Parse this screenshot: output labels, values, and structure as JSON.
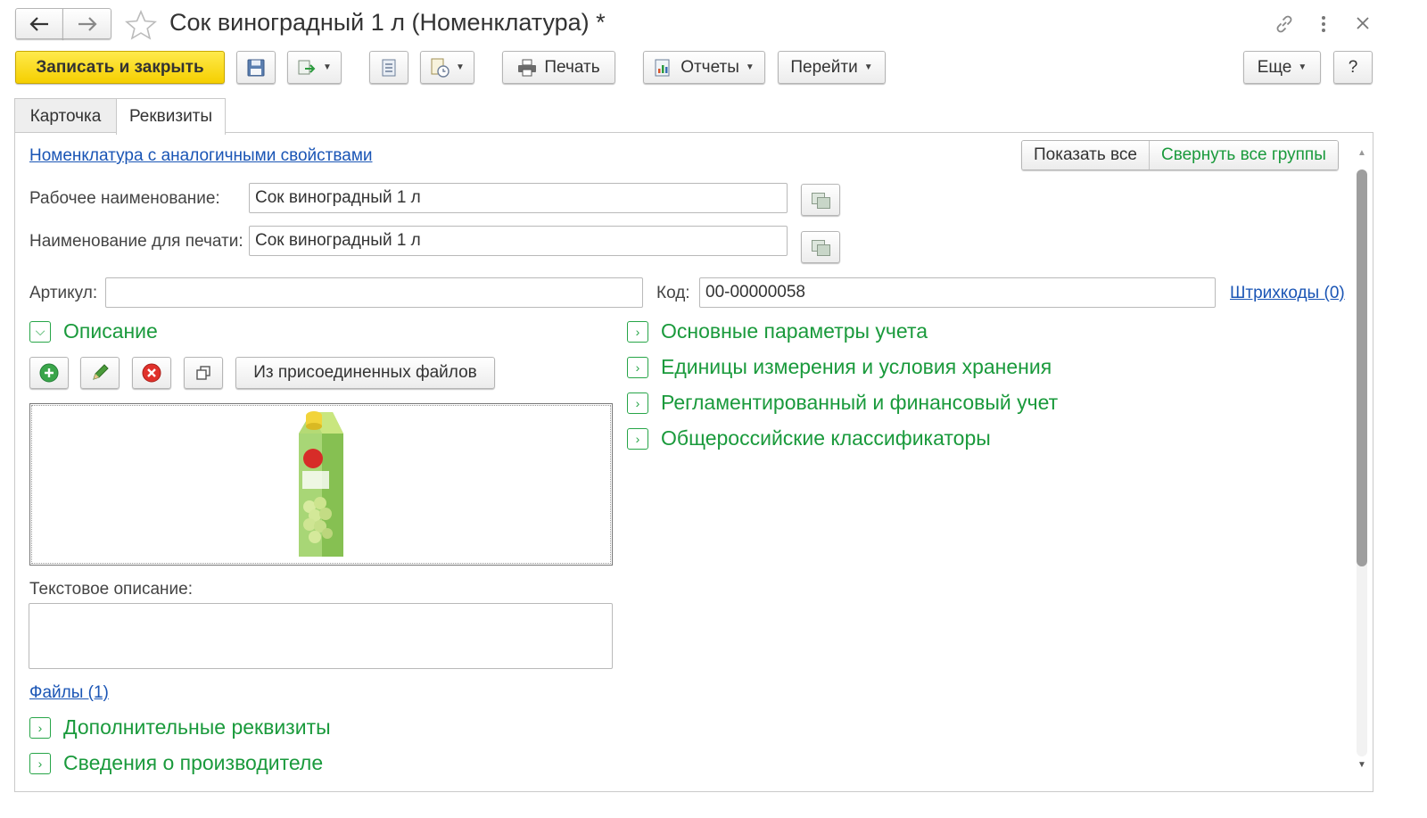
{
  "window": {
    "title": "Сок виноградный 1 л (Номенклатура) *"
  },
  "toolbar": {
    "save_close_label": "Записать и закрыть",
    "print_label": "Печать",
    "reports_label": "Отчеты",
    "goto_label": "Перейти",
    "more_label": "Еще",
    "help_label": "?"
  },
  "tabs": [
    {
      "label": "Карточка"
    },
    {
      "label": "Реквизиты"
    }
  ],
  "links": {
    "similar": "Номенклатура с аналогичными свойствами",
    "barcodes": "Штрихкоды (0)",
    "files": "Файлы (1)"
  },
  "top_buttons": {
    "show_all": "Показать все",
    "collapse_all": "Свернуть все группы"
  },
  "fields": {
    "work_name": {
      "label": "Рабочее наименование:",
      "value": "Сок виноградный 1 л"
    },
    "print_name": {
      "label": "Наименование для печати:",
      "value": "Сок виноградный 1 л"
    },
    "article": {
      "label": "Артикул:",
      "value": ""
    },
    "code": {
      "label": "Код:",
      "value": "00-00000058"
    },
    "text_desc": {
      "label": "Текстовое описание:",
      "value": ""
    }
  },
  "description": {
    "group_label": "Описание",
    "from_files_label": "Из присоединенных файлов"
  },
  "right_groups": [
    {
      "label": "Основные параметры учета"
    },
    {
      "label": "Единицы измерения и условия хранения"
    },
    {
      "label": "Регламентированный и финансовый учет"
    },
    {
      "label": "Общероссийские классификаторы"
    }
  ],
  "bottom_groups": [
    {
      "label": "Дополнительные реквизиты"
    },
    {
      "label": "Сведения о производителе"
    }
  ],
  "colors": {
    "accent_green": "#1a9a3c",
    "primary_yellow": "#f5cf00",
    "link_blue": "#1a55b5"
  }
}
